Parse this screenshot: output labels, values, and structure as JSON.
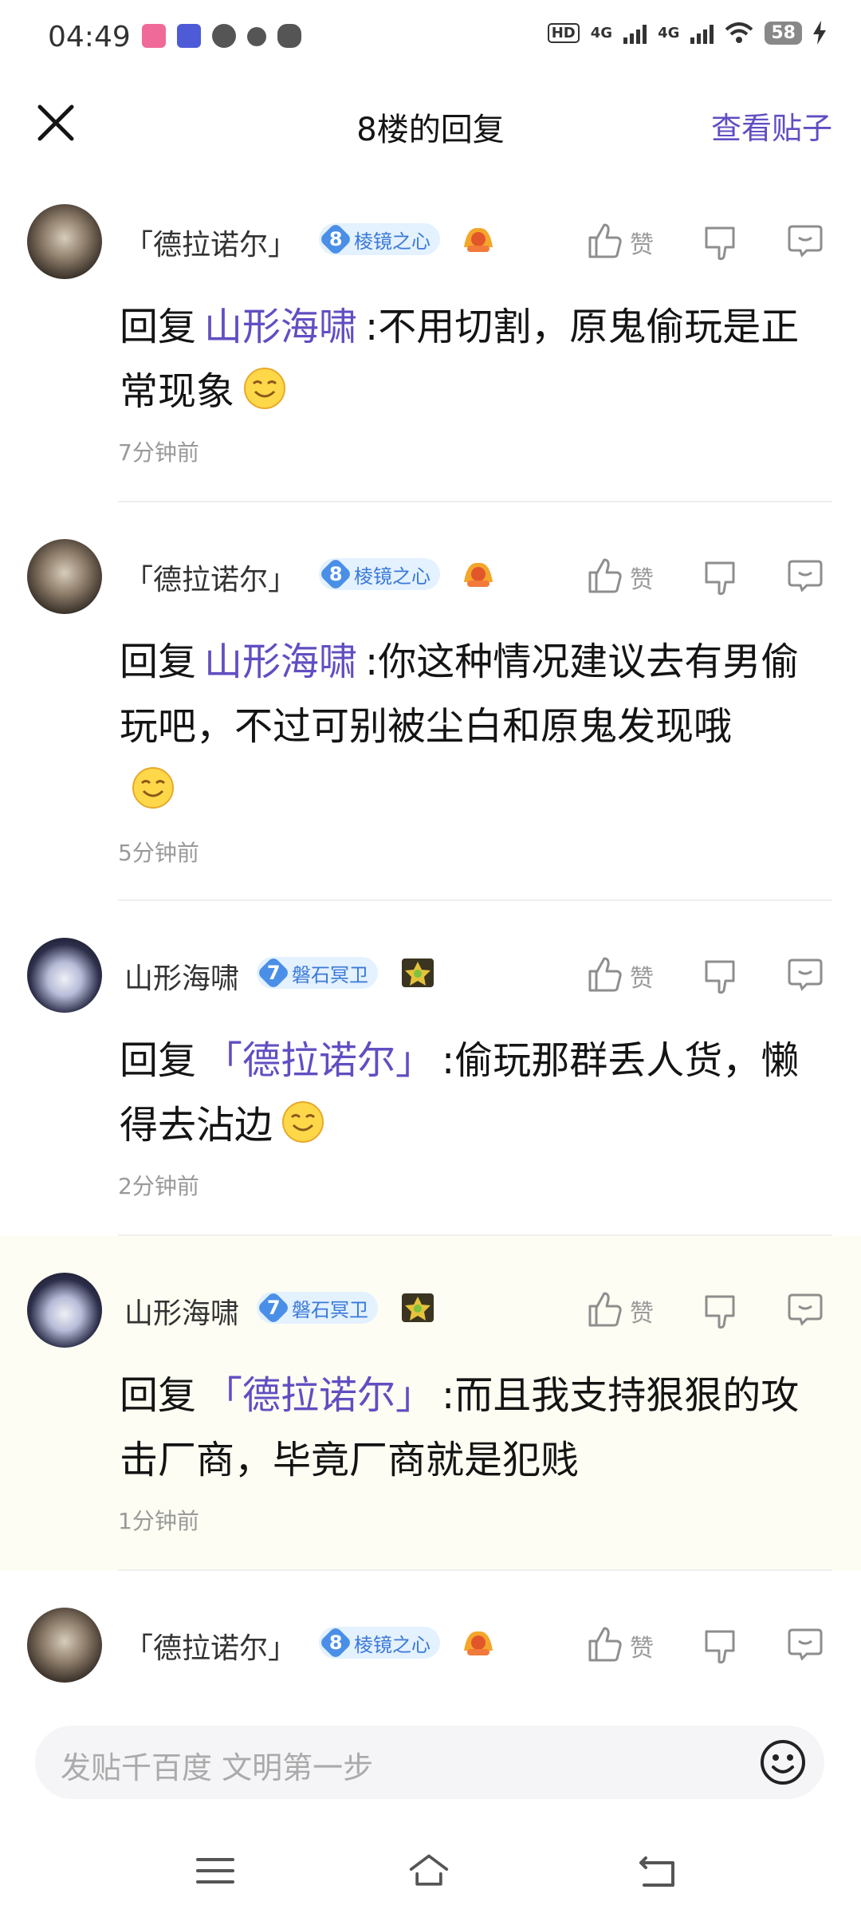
{
  "status_bar": {
    "time": "04:49",
    "network": "4G",
    "network2": "4G",
    "battery": "58"
  },
  "header": {
    "title": "8楼的回复",
    "view_post": "查看贴子"
  },
  "replies": [
    {
      "username": "「德拉诺尔」",
      "level": "8",
      "level_name": "棱镜之心",
      "reply_word": "回复",
      "target": "山形海啸",
      "text": ":不用切割，原鬼偷玩是正常现象",
      "time": "7分钟前",
      "zan": "赞"
    },
    {
      "username": "「德拉诺尔」",
      "level": "8",
      "level_name": "棱镜之心",
      "reply_word": "回复",
      "target": "山形海啸",
      "text": ":你这种情况建议去有男偷玩吧，不过可别被尘白和原鬼发现哦",
      "time": "5分钟前",
      "zan": "赞"
    },
    {
      "username": "山形海啸",
      "level": "7",
      "level_name": "磐石冥卫",
      "reply_word": "回复",
      "target": "「德拉诺尔」",
      "text": ":偷玩那群丢人货，懒得去沾边",
      "time": "2分钟前",
      "zan": "赞"
    },
    {
      "username": "山形海啸",
      "level": "7",
      "level_name": "磐石冥卫",
      "reply_word": "回复",
      "target": "「德拉诺尔」",
      "text": ":而且我支持狠狠的攻击厂商，毕竟厂商就是犯贱",
      "time": "1分钟前",
      "zan": "赞"
    },
    {
      "username": "「德拉诺尔」",
      "level": "8",
      "level_name": "棱镜之心",
      "zan": "赞"
    }
  ],
  "input": {
    "placeholder": "发贴千百度 文明第一步"
  },
  "colors": {
    "accent": "#614ec2",
    "level_blue": "#3979d8",
    "highlight_bg": "#fdfdf3"
  },
  "icons": [
    "close-icon",
    "thumb-up-icon",
    "thumb-down-icon",
    "comment-icon",
    "emoji-icon",
    "menu-icon",
    "home-icon",
    "back-icon"
  ]
}
